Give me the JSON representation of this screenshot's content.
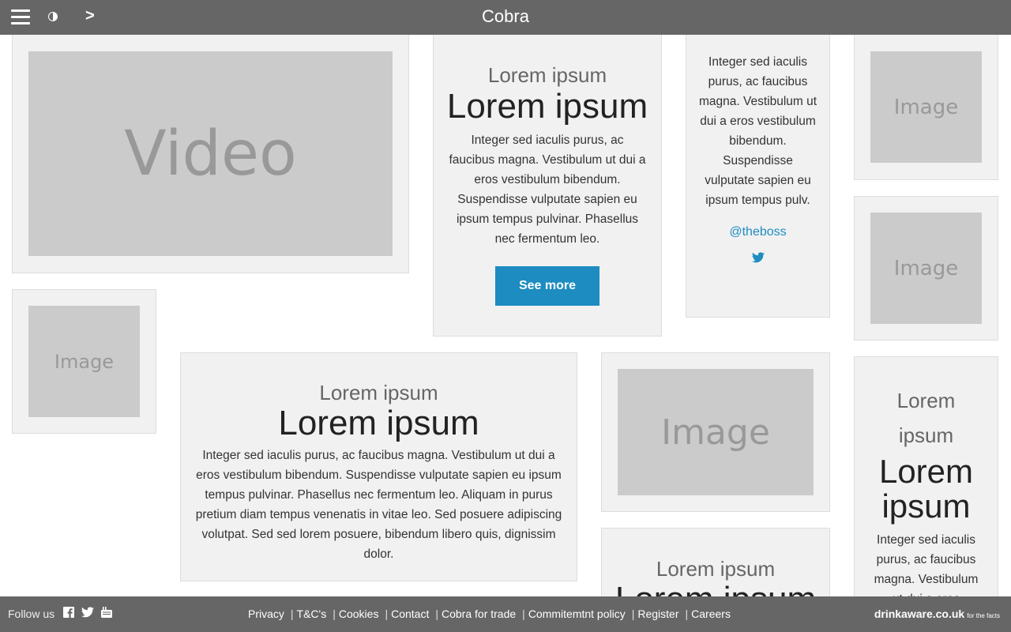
{
  "header": {
    "brand": "Cobra"
  },
  "tiles": {
    "video": {
      "label": "Video"
    },
    "image_label": "Image"
  },
  "feature_card": {
    "kicker": "Lorem ipsum",
    "headline": "Lorem ipsum",
    "body": "Integer sed iaculis purus, ac faucibus magna. Vestibulum ut dui a eros vestibulum bibendum. Suspendisse vulputate sapien eu ipsum tempus pulvinar. Phasellus nec fermentum leo.",
    "button": "See more"
  },
  "tweet_card": {
    "body": "Integer sed iaculis purus, ac faucibus magna. Vestibulum ut dui a eros vestibulum bibendum. Suspendisse vulputate sapien eu ipsum tempus pulv.",
    "handle": "@theboss",
    "icon": "twitter-icon"
  },
  "wide_card": {
    "kicker": "Lorem ipsum",
    "headline": "Lorem ipsum",
    "body": "Integer sed iaculis purus, ac faucibus magna. Vestibulum ut dui a eros vestibulum bibendum. Suspendisse vulputate sapien eu ipsum tempus pulvinar. Phasellus nec fermentum leo. Aliquam in purus pretium diam tempus venenatis in vitae leo. Sed posuere adipiscing volutpat. Sed sed lorem posuere, bibendum libero quis, dignissim dolor."
  },
  "bottom_card": {
    "kicker": "Lorem ipsum",
    "headline": "Lorem ipsum"
  },
  "narrow_card": {
    "kicker": "Lorem ipsum",
    "headline": "Lorem ipsum",
    "body": "Integer sed iaculis purus, ac faucibus magna. Vestibulum ut dui a eros"
  },
  "footer": {
    "follow": "Follow us",
    "links": [
      "Privacy",
      "T&C's",
      "Cookies",
      "Contact",
      "Cobra for trade",
      "Commitemtnt policy",
      "Register",
      "Careers"
    ],
    "drinkaware": "drinkaware.co.uk",
    "drinkaware_tag": "for the facts"
  },
  "colors": {
    "bar": "#666666",
    "card": "#f1f1f1",
    "placeholder": "#cbcbcb",
    "accent": "#1d8cc1"
  }
}
